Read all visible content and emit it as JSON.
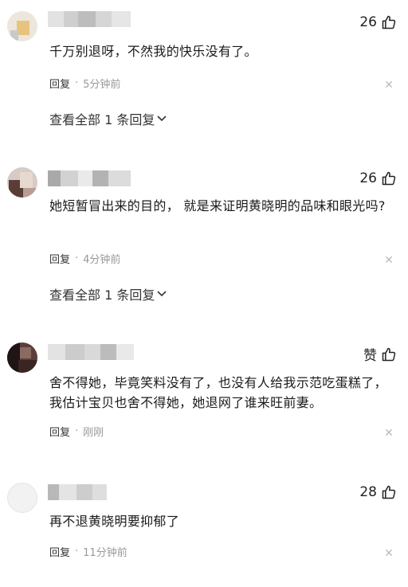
{
  "comments": [
    {
      "likes": "26",
      "text": "千万别退呀，不然我的快乐没有了。",
      "reply_label": "回复",
      "dot": "·",
      "time": "5分钟前",
      "view_all": "查看全部 1 条回复"
    },
    {
      "likes": "26",
      "text": "她短暂冒出来的目的，  就是来证明黄晓明的品味和眼光吗?",
      "reply_label": "回复",
      "dot": "·",
      "time": "4分钟前",
      "view_all": "查看全部 1 条回复"
    },
    {
      "likes": "赞",
      "text": "舍不得她，毕竟笑料没有了，也没有人给我示范吃蛋糕了，我估计宝贝也舍不得她，她退网了谁来旺前妻。",
      "reply_label": "回复",
      "dot": "·",
      "time": "刚刚"
    },
    {
      "likes": "28",
      "text": "再不退黄晓明要抑郁了",
      "reply_label": "回复",
      "dot": "·",
      "time": "11分钟前"
    }
  ],
  "icons": {
    "like": "thumbs-up-icon",
    "close": "close-icon",
    "expand": "chevron-down-icon"
  },
  "colors": {
    "text": "#1a1a1a",
    "meta": "#999999",
    "close": "#bbbbbb"
  }
}
